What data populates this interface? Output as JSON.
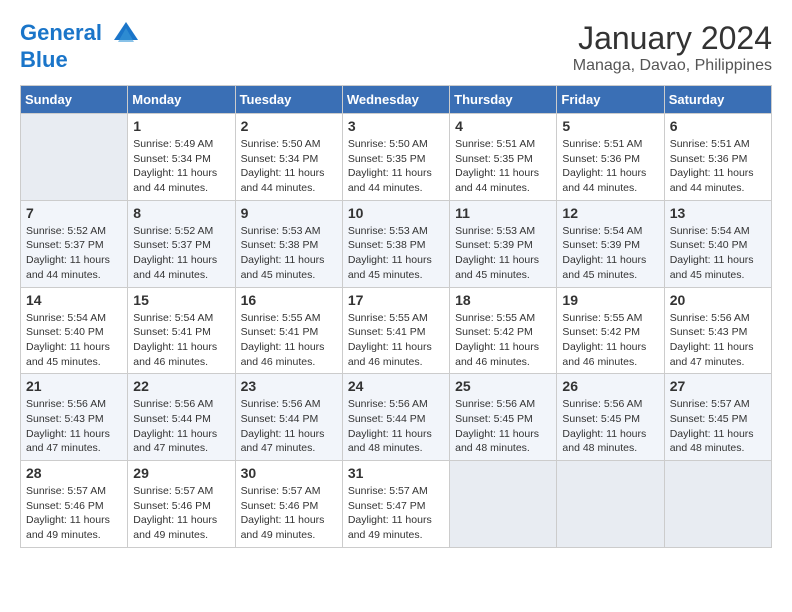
{
  "header": {
    "logo_line1": "General",
    "logo_line2": "Blue",
    "month": "January 2024",
    "location": "Managa, Davao, Philippines"
  },
  "weekdays": [
    "Sunday",
    "Monday",
    "Tuesday",
    "Wednesday",
    "Thursday",
    "Friday",
    "Saturday"
  ],
  "weeks": [
    [
      {
        "day": "",
        "info": ""
      },
      {
        "day": "1",
        "info": "Sunrise: 5:49 AM\nSunset: 5:34 PM\nDaylight: 11 hours\nand 44 minutes."
      },
      {
        "day": "2",
        "info": "Sunrise: 5:50 AM\nSunset: 5:34 PM\nDaylight: 11 hours\nand 44 minutes."
      },
      {
        "day": "3",
        "info": "Sunrise: 5:50 AM\nSunset: 5:35 PM\nDaylight: 11 hours\nand 44 minutes."
      },
      {
        "day": "4",
        "info": "Sunrise: 5:51 AM\nSunset: 5:35 PM\nDaylight: 11 hours\nand 44 minutes."
      },
      {
        "day": "5",
        "info": "Sunrise: 5:51 AM\nSunset: 5:36 PM\nDaylight: 11 hours\nand 44 minutes."
      },
      {
        "day": "6",
        "info": "Sunrise: 5:51 AM\nSunset: 5:36 PM\nDaylight: 11 hours\nand 44 minutes."
      }
    ],
    [
      {
        "day": "7",
        "info": "Sunrise: 5:52 AM\nSunset: 5:37 PM\nDaylight: 11 hours\nand 44 minutes."
      },
      {
        "day": "8",
        "info": "Sunrise: 5:52 AM\nSunset: 5:37 PM\nDaylight: 11 hours\nand 44 minutes."
      },
      {
        "day": "9",
        "info": "Sunrise: 5:53 AM\nSunset: 5:38 PM\nDaylight: 11 hours\nand 45 minutes."
      },
      {
        "day": "10",
        "info": "Sunrise: 5:53 AM\nSunset: 5:38 PM\nDaylight: 11 hours\nand 45 minutes."
      },
      {
        "day": "11",
        "info": "Sunrise: 5:53 AM\nSunset: 5:39 PM\nDaylight: 11 hours\nand 45 minutes."
      },
      {
        "day": "12",
        "info": "Sunrise: 5:54 AM\nSunset: 5:39 PM\nDaylight: 11 hours\nand 45 minutes."
      },
      {
        "day": "13",
        "info": "Sunrise: 5:54 AM\nSunset: 5:40 PM\nDaylight: 11 hours\nand 45 minutes."
      }
    ],
    [
      {
        "day": "14",
        "info": "Sunrise: 5:54 AM\nSunset: 5:40 PM\nDaylight: 11 hours\nand 45 minutes."
      },
      {
        "day": "15",
        "info": "Sunrise: 5:54 AM\nSunset: 5:41 PM\nDaylight: 11 hours\nand 46 minutes."
      },
      {
        "day": "16",
        "info": "Sunrise: 5:55 AM\nSunset: 5:41 PM\nDaylight: 11 hours\nand 46 minutes."
      },
      {
        "day": "17",
        "info": "Sunrise: 5:55 AM\nSunset: 5:41 PM\nDaylight: 11 hours\nand 46 minutes."
      },
      {
        "day": "18",
        "info": "Sunrise: 5:55 AM\nSunset: 5:42 PM\nDaylight: 11 hours\nand 46 minutes."
      },
      {
        "day": "19",
        "info": "Sunrise: 5:55 AM\nSunset: 5:42 PM\nDaylight: 11 hours\nand 46 minutes."
      },
      {
        "day": "20",
        "info": "Sunrise: 5:56 AM\nSunset: 5:43 PM\nDaylight: 11 hours\nand 47 minutes."
      }
    ],
    [
      {
        "day": "21",
        "info": "Sunrise: 5:56 AM\nSunset: 5:43 PM\nDaylight: 11 hours\nand 47 minutes."
      },
      {
        "day": "22",
        "info": "Sunrise: 5:56 AM\nSunset: 5:44 PM\nDaylight: 11 hours\nand 47 minutes."
      },
      {
        "day": "23",
        "info": "Sunrise: 5:56 AM\nSunset: 5:44 PM\nDaylight: 11 hours\nand 47 minutes."
      },
      {
        "day": "24",
        "info": "Sunrise: 5:56 AM\nSunset: 5:44 PM\nDaylight: 11 hours\nand 48 minutes."
      },
      {
        "day": "25",
        "info": "Sunrise: 5:56 AM\nSunset: 5:45 PM\nDaylight: 11 hours\nand 48 minutes."
      },
      {
        "day": "26",
        "info": "Sunrise: 5:56 AM\nSunset: 5:45 PM\nDaylight: 11 hours\nand 48 minutes."
      },
      {
        "day": "27",
        "info": "Sunrise: 5:57 AM\nSunset: 5:45 PM\nDaylight: 11 hours\nand 48 minutes."
      }
    ],
    [
      {
        "day": "28",
        "info": "Sunrise: 5:57 AM\nSunset: 5:46 PM\nDaylight: 11 hours\nand 49 minutes."
      },
      {
        "day": "29",
        "info": "Sunrise: 5:57 AM\nSunset: 5:46 PM\nDaylight: 11 hours\nand 49 minutes."
      },
      {
        "day": "30",
        "info": "Sunrise: 5:57 AM\nSunset: 5:46 PM\nDaylight: 11 hours\nand 49 minutes."
      },
      {
        "day": "31",
        "info": "Sunrise: 5:57 AM\nSunset: 5:47 PM\nDaylight: 11 hours\nand 49 minutes."
      },
      {
        "day": "",
        "info": ""
      },
      {
        "day": "",
        "info": ""
      },
      {
        "day": "",
        "info": ""
      }
    ]
  ]
}
